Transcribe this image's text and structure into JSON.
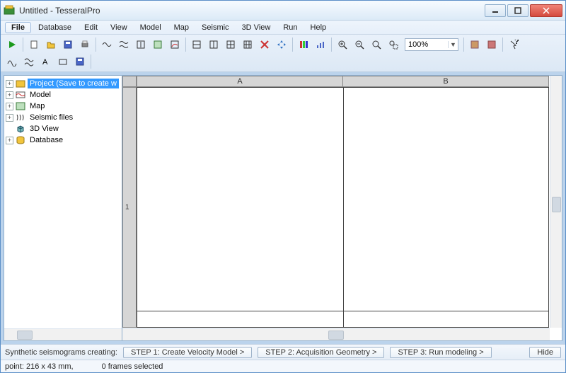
{
  "window": {
    "title": "Untitled - TesseralPro"
  },
  "menus": [
    "File",
    "Database",
    "Edit",
    "View",
    "Model",
    "Map",
    "Seismic",
    "3D View",
    "Run",
    "Help"
  ],
  "zoom": {
    "value": "100%"
  },
  "tree": {
    "items": [
      {
        "label": "Project (Save to create w",
        "icon": "project-icon",
        "expandable": true,
        "selected": true
      },
      {
        "label": "Model",
        "icon": "model-icon",
        "expandable": true
      },
      {
        "label": "Map",
        "icon": "map-icon",
        "expandable": true
      },
      {
        "label": "Seismic files",
        "icon": "seismic-icon",
        "expandable": true
      },
      {
        "label": "3D View",
        "icon": "cube3d-icon",
        "expandable": false
      },
      {
        "label": "Database",
        "icon": "database-icon",
        "expandable": true
      }
    ]
  },
  "sheet": {
    "col_a": "A",
    "col_b": "B",
    "row_1": "1"
  },
  "steps": {
    "label": "Synthetic seismograms creating:",
    "s1": "STEP 1: Create Velocity Model  >",
    "s2": "STEP 2: Acquisition Geometry  >",
    "s3": "STEP 3: Run modeling  >",
    "hide": "Hide"
  },
  "status": {
    "point": "point: 216 x 43 mm,",
    "frames": "0 frames selected"
  }
}
